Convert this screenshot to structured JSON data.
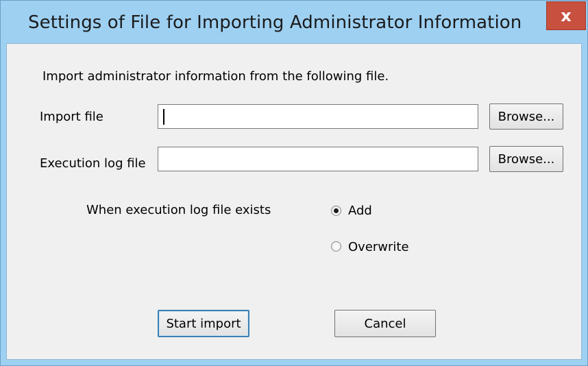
{
  "window": {
    "title": "Settings of File for Importing Administrator Information",
    "close_glyph": "x"
  },
  "intro_text": "Import administrator information from the following file.",
  "import_file": {
    "label": "Import file",
    "value": "",
    "browse_label": "Browse..."
  },
  "execution_log_file": {
    "label": "Execution log file",
    "value": "",
    "browse_label": "Browse..."
  },
  "log_exists": {
    "label": "When execution log file exists",
    "options": [
      {
        "label": "Add",
        "selected": true
      },
      {
        "label": "Overwrite",
        "selected": false
      }
    ]
  },
  "buttons": {
    "start_import": "Start import",
    "cancel": "Cancel"
  },
  "colors": {
    "title_bar": "#9ed0f2",
    "close_button": "#c7503f",
    "client_background": "#f0f0f0"
  }
}
